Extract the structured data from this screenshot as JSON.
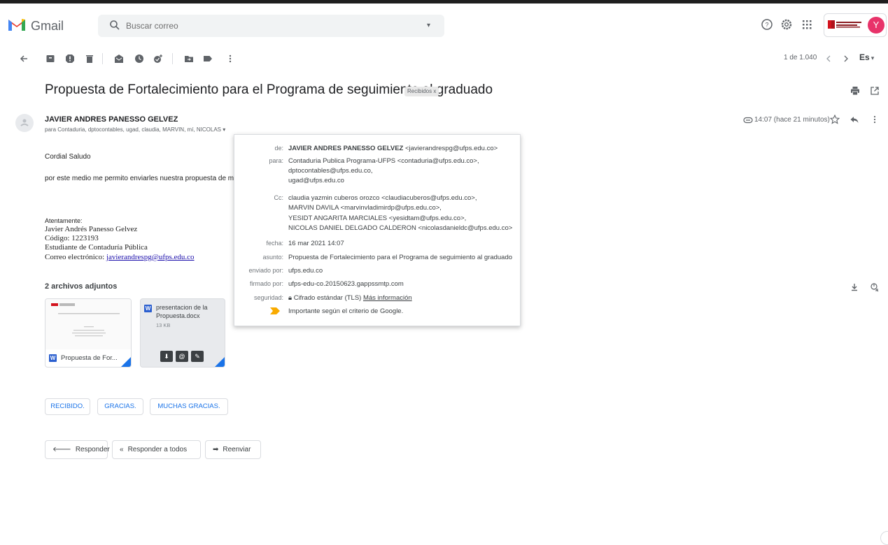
{
  "app": {
    "logo_text": "Gmail"
  },
  "search": {
    "placeholder": "Buscar correo"
  },
  "header_icons": [
    "help-icon",
    "settings-icon",
    "apps-grid-icon"
  ],
  "account": {
    "org_name": "Universidad Francisco de Paula Santander",
    "avatar_letter": "Y",
    "avatar_color": "#e8336a"
  },
  "toolbar": {
    "icons": [
      "back-arrow-icon",
      "archive-icon",
      "report-spam-icon",
      "delete-icon",
      "mark-unread-icon",
      "snooze-icon",
      "add-task-icon",
      "move-to-icon",
      "label-icon",
      "more-icon"
    ],
    "pager": "1 de 1.040",
    "lang": "Es"
  },
  "email": {
    "subject": "Propuesta de Fortalecimiento para el Programa de seguimiento al graduado",
    "label": "Recibidos x",
    "sender": "JAVIER ANDRES PANESSO GELVEZ",
    "recipients_line": "para Contaduria, dptocontables, ugad, claudia, MARVIN, mí, NICOLAS",
    "time": "14:07 (hace 21 minutos)",
    "greeting": "Cordial Saludo",
    "body_line": "por este medio me permito enviarles nuestra propuesta de mejoram",
    "sig_closing": "Atentamente:",
    "sig_name": "Javier Andrés Panesso Gelvez",
    "sig_code": "Código: 1223193",
    "sig_role": "Estudiante de Contaduría Pública",
    "sig_email_label": "Correo electrónico:",
    "sig_email": "javierandrespg@ufps.edu.co"
  },
  "details": {
    "de_label": "de:",
    "de_name": "JAVIER ANDRES PANESSO GELVEZ",
    "de_addr": "<javierandrespg@ufps.edu.co>",
    "para_label": "para:",
    "para_lines": [
      "Contaduria Publica Programa-UFPS <contaduria@ufps.edu.co>,",
      "dptocontables@ufps.edu.co,",
      "ugad@ufps.edu.co"
    ],
    "cc_label": "Cc:",
    "cc_lines": [
      "claudia yazmin cuberos orozco <claudiacuberos@ufps.edu.co>,",
      "MARVIN DAVILA <marvinvladimirdp@ufps.edu.co>,",
      "YESIDT ANGARITA MARCIALES <yesidtam@ufps.edu.co>,",
      "NICOLAS DANIEL DELGADO CALDERON <nicolasdanieldc@ufps.edu.co>"
    ],
    "fecha_label": "fecha:",
    "fecha": "16 mar 2021 14:07",
    "asunto_label": "asunto:",
    "asunto": "Propuesta de Fortalecimiento para el Programa de seguimiento al graduado",
    "enviado_label": "enviado por:",
    "enviado": "ufps.edu.co",
    "firmado_label": "firmado por:",
    "firmado": "ufps-edu-co.20150623.gappssmtp.com",
    "seguridad_label": "seguridad:",
    "seguridad": "Cifrado estándar (TLS)",
    "mas_info": "Más información",
    "importance": "Importante según el criterio de Google."
  },
  "attachments": {
    "title": "2 archivos adjuntos",
    "items": [
      {
        "name": "Propuesta de For...",
        "type": "W"
      },
      {
        "name_line1": "presentacion de la",
        "name_line2": "Propuesta.docx",
        "size": "13 KB",
        "type": "W"
      }
    ]
  },
  "smart_replies": [
    "RECIBIDO.",
    "GRACIAS.",
    "MUCHAS GRACIAS."
  ],
  "actions": {
    "reply": "Responder",
    "reply_all": "Responder a todos",
    "forward": "Reenviar"
  }
}
